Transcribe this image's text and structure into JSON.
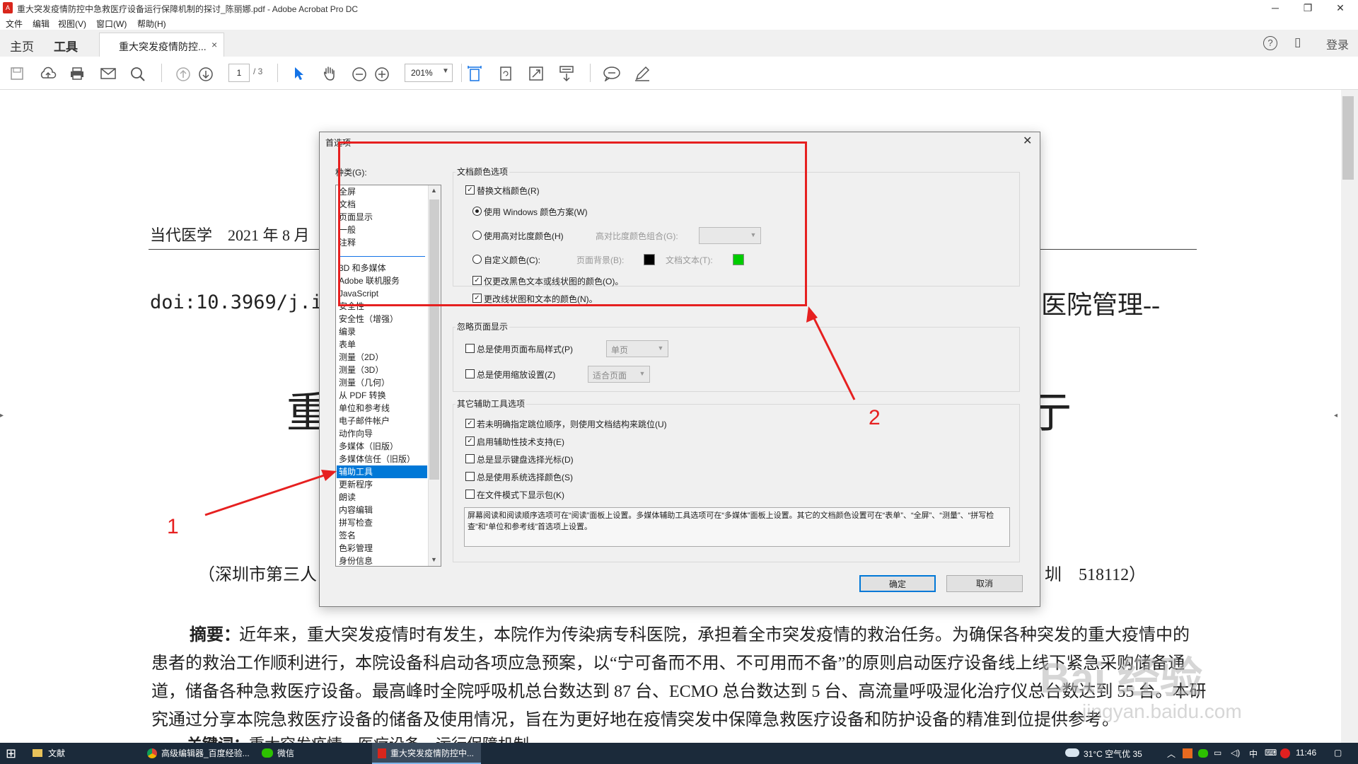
{
  "window": {
    "title": "重大突发疫情防控中急救医疗设备运行保障机制的探讨_陈丽娜.pdf - Adobe Acrobat Pro DC",
    "app_icon_text": "A",
    "min": "─",
    "restore": "❐",
    "close": "✕"
  },
  "menu": [
    "文件",
    "编辑",
    "视图(V)",
    "窗口(W)",
    "帮助(H)"
  ],
  "nav": {
    "home": "主页",
    "tools": "工具",
    "doc_tab": "重大突发疫情防控...",
    "doc_tab_close": "×",
    "help_icon": "?",
    "mobile_icon": "▯",
    "login": "登录"
  },
  "toolbar": {
    "page_current": "1",
    "page_total": "/ 3",
    "zoom": "201%",
    "icons": [
      "save-icon",
      "upload-icon",
      "print-icon",
      "mail-icon",
      "search-icon",
      "page-up-icon",
      "page-down-icon",
      "select-icon",
      "hand-icon",
      "zoom-out-icon",
      "zoom-in-icon",
      "fit-width-icon",
      "rotate-icon",
      "fullscreen-icon",
      "scroll-icon",
      "comment-icon",
      "sign-icon"
    ]
  },
  "document": {
    "journal": "当代医学　2021 年 8 月",
    "doi": "doi:10.3969/j.i",
    "title_left": "重",
    "title_right": "亍",
    "right_fragment": "-医院管理--",
    "affil_left": "（深圳市第三人",
    "affil_right": "圳　518112）",
    "abstract_label": "摘要：",
    "abstract_lines": [
      "近年来，重大突发疫情时有发生，本院作为传染病专科医院，承担着全市突发疫情的救治任务。为确保各种突发的重大疫情中的",
      "患者的救治工作顺利进行，本院设备科启动各项应急预案，以“宁可备而不用、不可用而不备”的原则启动医疗设备线上线下紧急采购储备通",
      "道，储备各种急救医疗设备。最高峰时全院呼吸机总台数达到 87 台、ECMO 总台数达到 5 台、高流量呼吸湿化治疗仪总台数达到 55 台。本研",
      "究通过分享本院急救医疗设备的储备及使用情况，旨在为更好地在疫情突发中保障急救医疗设备和防护设备的精准到位提供参考。"
    ],
    "keywords_label": "关键词：",
    "keywords": "重大突发疫情　医疗设备　运行保障机制"
  },
  "watermark": {
    "logo": "Bai  经验",
    "url": "jingyan.baidu.com"
  },
  "dialog": {
    "title": "首选项",
    "close": "✕",
    "category_label": "种类(G):",
    "categories_top": [
      "全屏",
      "文档",
      "页面显示",
      "一般",
      "注释"
    ],
    "categories": [
      "3D 和多媒体",
      "Adobe 联机服务",
      "JavaScript",
      "安全性",
      "安全性（增强）",
      "编录",
      "表单",
      "测量（2D）",
      "测量（3D）",
      "测量（几何）",
      "从 PDF 转换",
      "单位和参考线",
      "电子邮件帐户",
      "动作向导",
      "多媒体（旧版）",
      "多媒体信任（旧版）",
      "辅助工具",
      "更新程序",
      "朗读",
      "内容编辑",
      "拼写检查",
      "签名",
      "色彩管理",
      "身份信息"
    ],
    "selected_category": "辅助工具",
    "doc_color": {
      "group": "文档颜色选项",
      "replace": "替换文档颜色(R)",
      "use_windows": "使用 Windows 颜色方案(W)",
      "use_high_contrast": "使用高对比度颜色(H)",
      "hc_combo_label": "高对比度颜色组合(G):",
      "custom": "自定义颜色(C):",
      "page_bg_label": "页面背景(B):",
      "doc_text_label": "文档文本(T):",
      "page_bg_color": "#000000",
      "doc_text_color": "#00cc00",
      "only_black": "仅更改黑色文本或线状图的颜色(O)。",
      "change_line": "更改线状图和文本的颜色(N)。"
    },
    "override": {
      "group": "忽略页面显示",
      "layout": "总是使用页面布局样式(P)",
      "layout_value": "单页",
      "zoom": "总是使用缩放设置(Z)",
      "zoom_value": "适合页面"
    },
    "other": {
      "group": "其它辅助工具选项",
      "o1": "若未明确指定跳位顺序，则使用文档结构来跳位(U)",
      "o2": "启用辅助性技术支持(E)",
      "o3": "总是显示键盘选择光标(D)",
      "o4": "总是使用系统选择颜色(S)",
      "o5": "在文件模式下显示包(K)"
    },
    "note": "屏幕阅读和阅读顺序选项可在“阅读”面板上设置。多媒体辅助工具选项可在“多媒体”面板上设置。其它的文档颜色设置可在“表单”、“全屏”、“测量”、“拼写检查”和“单位和参考线”首选项上设置。",
    "ok": "确定",
    "cancel": "取消"
  },
  "annotations": {
    "n1": "1",
    "n2": "2",
    "color": "#e62020"
  },
  "taskbar": {
    "start": "⊞",
    "items": [
      "文献",
      "高级编辑器_百度经验...",
      "微信",
      "重大突发疫情防控中..."
    ],
    "weather": "31°C 空气优 35",
    "ime": "中",
    "time": "11:46"
  }
}
